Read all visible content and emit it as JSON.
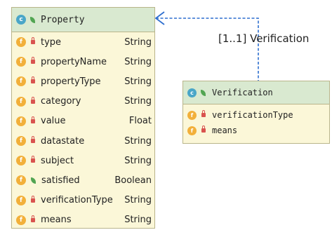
{
  "property_class": {
    "name": "Property",
    "badge": "c",
    "icon": "leaf-icon",
    "fields": [
      {
        "badge": "f",
        "visibility": "private",
        "name": "type",
        "type": "String"
      },
      {
        "badge": "f",
        "visibility": "private",
        "name": "propertyName",
        "type": "String"
      },
      {
        "badge": "f",
        "visibility": "private",
        "name": "propertyType",
        "type": "String"
      },
      {
        "badge": "f",
        "visibility": "private",
        "name": "category",
        "type": "String"
      },
      {
        "badge": "f",
        "visibility": "private",
        "name": "value",
        "type": "Float"
      },
      {
        "badge": "f",
        "visibility": "private",
        "name": "datastate",
        "type": "String"
      },
      {
        "badge": "f",
        "visibility": "private",
        "name": "subject",
        "type": "String"
      },
      {
        "badge": "f",
        "visibility": "public",
        "name": "satisfied",
        "type": "Boolean"
      },
      {
        "badge": "f",
        "visibility": "private",
        "name": "verificationType",
        "type": "String"
      },
      {
        "badge": "f",
        "visibility": "private",
        "name": "means",
        "type": "String"
      }
    ]
  },
  "verification_class": {
    "name": "Verification",
    "badge": "c",
    "icon": "leaf-icon",
    "fields": [
      {
        "badge": "f",
        "visibility": "private",
        "name": "verificationType"
      },
      {
        "badge": "f",
        "visibility": "private",
        "name": "means"
      }
    ]
  },
  "association": {
    "label": "[1..1] Verification",
    "line_color": "#2f6fcf"
  },
  "colors": {
    "class_bg": "#fbf7d8",
    "header_bg": "#d9e9d0",
    "class_badge": "#4aa6c8",
    "field_badge": "#f2b03a",
    "private_icon": "#d9534f",
    "public_icon": "#52a552"
  }
}
